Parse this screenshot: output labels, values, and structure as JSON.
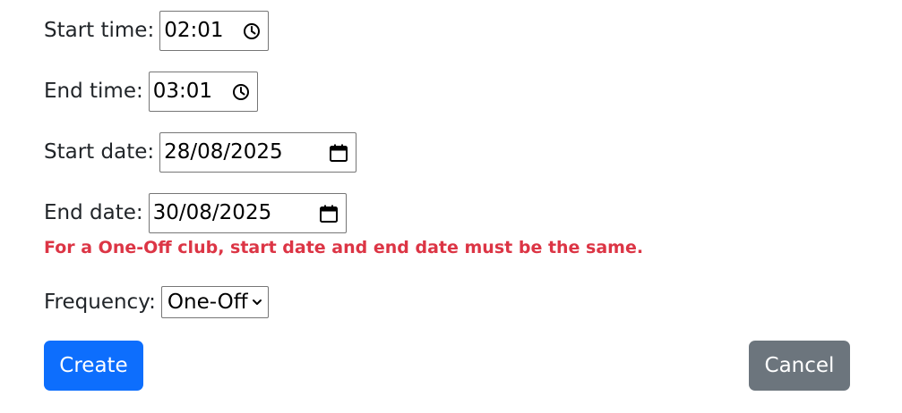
{
  "form": {
    "start_time": {
      "label": "Start time:",
      "value": "02:01",
      "icon": "clock-icon"
    },
    "end_time": {
      "label": "End time:",
      "value": "03:01",
      "icon": "clock-icon"
    },
    "start_date": {
      "label": "Start date:",
      "value": "28/08/2025",
      "icon": "calendar-icon"
    },
    "end_date": {
      "label": "End date:",
      "value": "30/08/2025",
      "icon": "calendar-icon"
    },
    "error_message": "For a One-Off club, start date and end date must be the same.",
    "frequency": {
      "label": "Frequency:",
      "value": "One-Off",
      "icon": "chevron-down-icon"
    }
  },
  "actions": {
    "create_label": "Create",
    "cancel_label": "Cancel"
  },
  "colors": {
    "primary": "#0d6efd",
    "secondary": "#6c757d",
    "error": "#dc3545"
  }
}
